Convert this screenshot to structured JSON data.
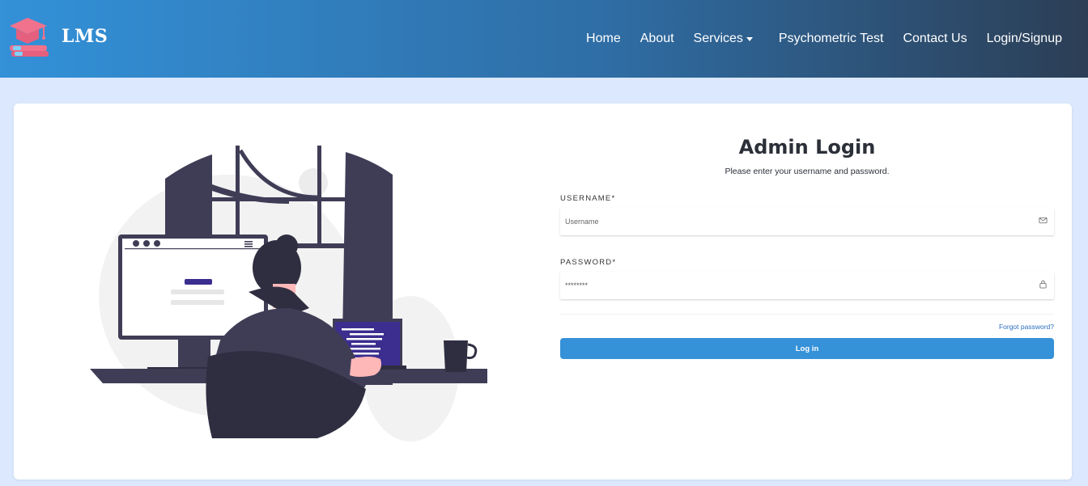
{
  "brand": {
    "name": "LMS"
  },
  "nav": {
    "items": [
      {
        "label": "Home"
      },
      {
        "label": "About"
      },
      {
        "label": "Services"
      },
      {
        "label": "Psychometric Test"
      },
      {
        "label": "Contact Us"
      },
      {
        "label": "Login/Signup"
      }
    ]
  },
  "login": {
    "title": "Admin Login",
    "subtitle": "Please enter your username and password.",
    "username_label": "USERNAME*",
    "username_placeholder": "Username",
    "password_label": "PASSWORD*",
    "password_value": "********",
    "forgot": "Forgot password?",
    "submit": "Log in"
  },
  "colors": {
    "header_start": "#3391d8",
    "header_end": "#2c3e55",
    "button": "#3591d8",
    "link": "#2a6ec0",
    "page_bg": "#dbe8fd"
  },
  "icons": {
    "username": "envelope-icon",
    "password": "lock-icon",
    "services": "caret-down-icon"
  }
}
